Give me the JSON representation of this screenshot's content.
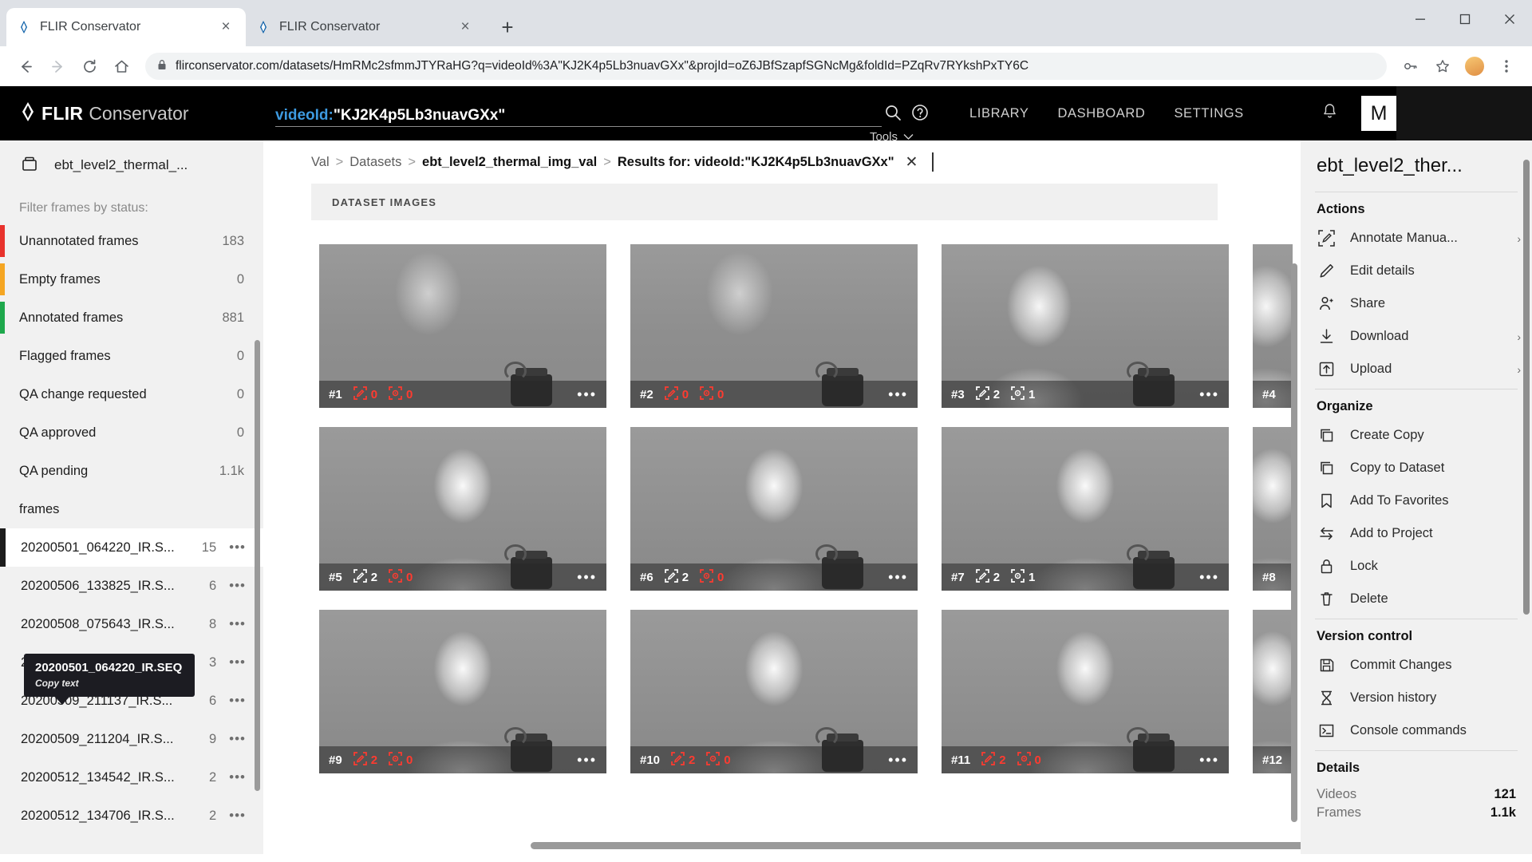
{
  "browser": {
    "tabs": [
      {
        "title": "FLIR Conservator",
        "active": true,
        "favicon": "flir-diamond-icon"
      },
      {
        "title": "FLIR Conservator",
        "active": false,
        "favicon": "flir-diamond-icon"
      }
    ],
    "new_tab_label": "+",
    "close_label": "×",
    "url": "flirconservator.com/datasets/HmRMc2sfmmJTYRaHG?q=videoId%3A\"KJ2K4p5Lb3nuavGXx\"&projId=oZ6JBfSzapfSGNcMg&foldId=PZqRv7RYkshPxTY6C",
    "window_controls": {
      "minimize": "minimize-icon",
      "maximize": "maximize-icon",
      "close": "close-icon"
    }
  },
  "header": {
    "brand": "FLIR",
    "brand_sub": "Conservator",
    "search_key": "videoId:",
    "search_value": "\"KJ2K4p5Lb3nuavGXx\"",
    "tools_label": "Tools",
    "nav": [
      "LIBRARY",
      "DASHBOARD",
      "SETTINGS"
    ],
    "avatar_initial": "M"
  },
  "sidebar": {
    "dataset_name": "ebt_level2_thermal_...",
    "filter_label": "Filter frames by status:",
    "filters": [
      {
        "label": "Unannotated frames",
        "count": "183",
        "color": "#e8322c"
      },
      {
        "label": "Empty frames",
        "count": "0",
        "color": "#f5a623"
      },
      {
        "label": "Annotated frames",
        "count": "881",
        "color": "#1ea84c"
      },
      {
        "label": "Flagged frames",
        "count": "0",
        "color": "transparent"
      },
      {
        "label": "QA change requested",
        "count": "0",
        "color": "transparent"
      },
      {
        "label": "QA approved",
        "count": "0",
        "color": "transparent"
      },
      {
        "label": "QA pending",
        "count": "1.1k",
        "color": "transparent"
      },
      {
        "label": "frames",
        "count": "",
        "color": "transparent"
      }
    ],
    "tooltip": {
      "title": "20200501_064220_IR.SEQ",
      "subtitle": "Copy text"
    },
    "files": [
      {
        "name": "20200501_064220_IR.S...",
        "count": "15",
        "selected": true
      },
      {
        "name": "20200506_133825_IR.S...",
        "count": "6",
        "selected": false
      },
      {
        "name": "20200508_075643_IR.S...",
        "count": "8",
        "selected": false
      },
      {
        "name": "20200509_211120_IR.S...",
        "count": "3",
        "selected": false
      },
      {
        "name": "20200509_211137_IR.S...",
        "count": "6",
        "selected": false
      },
      {
        "name": "20200509_211204_IR.S...",
        "count": "9",
        "selected": false
      },
      {
        "name": "20200512_134542_IR.S...",
        "count": "2",
        "selected": false
      },
      {
        "name": "20200512_134706_IR.S...",
        "count": "2",
        "selected": false
      }
    ],
    "row_menu": "•••"
  },
  "breadcrumb": {
    "items": [
      {
        "text": "Val",
        "strong": false
      },
      {
        "text": "Datasets",
        "strong": false
      },
      {
        "text": "ebt_level2_thermal_img_val",
        "strong": true
      },
      {
        "text": "Results for: videoId:\"KJ2K4p5Lb3nuavGXx\"",
        "strong": true
      }
    ],
    "separator": ">",
    "close": "✕"
  },
  "grid": {
    "section_label": "DATASET IMAGES",
    "more_label": "•••",
    "rows": [
      [
        {
          "num": "#1",
          "annot": "0",
          "annot_color": "red",
          "objs": "0",
          "objs_color": "red",
          "style": "th-a",
          "clipped": false
        },
        {
          "num": "#2",
          "annot": "0",
          "annot_color": "red",
          "objs": "0",
          "objs_color": "red",
          "style": "th-a",
          "clipped": false
        },
        {
          "num": "#3",
          "annot": "2",
          "annot_color": "white",
          "objs": "1",
          "objs_color": "white",
          "style": "th-b",
          "clipped": false
        },
        {
          "num": "#4",
          "annot": "",
          "annot_color": "white",
          "objs": "",
          "objs_color": "white",
          "style": "th-b",
          "clipped": true
        }
      ],
      [
        {
          "num": "#5",
          "annot": "2",
          "annot_color": "white",
          "objs": "0",
          "objs_color": "red",
          "style": "th-c",
          "clipped": false
        },
        {
          "num": "#6",
          "annot": "2",
          "annot_color": "white",
          "objs": "0",
          "objs_color": "red",
          "style": "th-c",
          "clipped": false
        },
        {
          "num": "#7",
          "annot": "2",
          "annot_color": "white",
          "objs": "1",
          "objs_color": "white",
          "style": "th-c",
          "clipped": false
        },
        {
          "num": "#8",
          "annot": "",
          "annot_color": "white",
          "objs": "",
          "objs_color": "white",
          "style": "th-c",
          "clipped": true
        }
      ],
      [
        {
          "num": "#9",
          "annot": "2",
          "annot_color": "red",
          "objs": "0",
          "objs_color": "red",
          "style": "th-c",
          "clipped": false
        },
        {
          "num": "#10",
          "annot": "2",
          "annot_color": "red",
          "objs": "0",
          "objs_color": "red",
          "style": "th-c",
          "clipped": false
        },
        {
          "num": "#11",
          "annot": "2",
          "annot_color": "red",
          "objs": "0",
          "objs_color": "red",
          "style": "th-c",
          "clipped": false
        },
        {
          "num": "#12",
          "annot": "",
          "annot_color": "white",
          "objs": "",
          "objs_color": "white",
          "style": "th-c",
          "clipped": true
        }
      ]
    ]
  },
  "rightpanel": {
    "title": "ebt_level2_ther...",
    "sections": [
      {
        "title": "Actions",
        "items": [
          {
            "label": "Annotate Manua...",
            "icon": "annotate-manual-icon",
            "chevron": true
          },
          {
            "label": "Edit details",
            "icon": "pencil-icon",
            "chevron": false
          },
          {
            "label": "Share",
            "icon": "share-person-icon",
            "chevron": false
          },
          {
            "label": "Download",
            "icon": "download-icon",
            "chevron": true
          },
          {
            "label": "Upload",
            "icon": "upload-icon",
            "chevron": true
          }
        ]
      },
      {
        "title": "Organize",
        "items": [
          {
            "label": "Create Copy",
            "icon": "copy-icon",
            "chevron": false
          },
          {
            "label": "Copy to Dataset",
            "icon": "copy-icon",
            "chevron": false
          },
          {
            "label": "Add To Favorites",
            "icon": "bookmark-icon",
            "chevron": false
          },
          {
            "label": "Add to Project",
            "icon": "move-arrows-icon",
            "chevron": false
          },
          {
            "label": "Lock",
            "icon": "lock-icon",
            "chevron": false
          },
          {
            "label": "Delete",
            "icon": "trash-icon",
            "chevron": false
          }
        ]
      },
      {
        "title": "Version control",
        "items": [
          {
            "label": "Commit Changes",
            "icon": "save-icon",
            "chevron": false
          },
          {
            "label": "Version history",
            "icon": "hourglass-icon",
            "chevron": false
          },
          {
            "label": "Console commands",
            "icon": "console-icon",
            "chevron": false
          }
        ]
      }
    ],
    "details_title": "Details",
    "details": [
      {
        "key": "Videos",
        "value": "121"
      },
      {
        "key": "Frames",
        "value": "1.1k"
      }
    ],
    "chevron": "›"
  }
}
